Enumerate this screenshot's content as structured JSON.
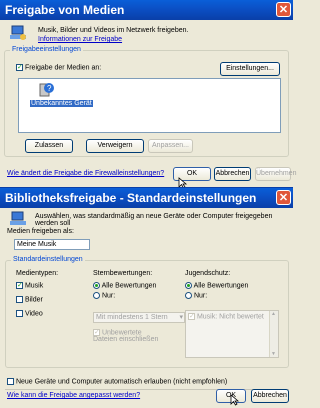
{
  "top": {
    "title": "Freigabe von Medien",
    "desc": "Musik, Bilder und Videos im Netzwerk freigeben.",
    "info_link": "Informationen zur Freigabe",
    "group_label": "Freigabeeinstellungen",
    "share_checkbox": "Freigabe der Medien an:",
    "settings_button": "Einstellungen...",
    "device_label": "Unbekanntes Gerät",
    "allow_button": "Zulassen",
    "deny_button": "Verweigern",
    "customize_button": "Anpassen...",
    "firewall_link": "Wie ändert die Freigabe die Firewalleinstellungen?",
    "ok_button": "OK",
    "cancel_button": "Abbrechen",
    "apply_button": "Übernehmen"
  },
  "bottom": {
    "title": "Bibliotheksfreigabe - Standardeinstellungen",
    "desc": "Auswählen, was standardmäßig an neue Geräte oder Computer freigegeben werden soll",
    "share_as_label": "Medien freigeben als:",
    "share_name_value": "Meine Musik",
    "group_label": "Standardeinstellungen",
    "media_types_label": "Medientypen:",
    "music": "Musik",
    "pictures": "Bilder",
    "video": "Video",
    "star_label": "Sternbewertungen:",
    "all_ratings": "Alle Bewertungen",
    "only": "Nur:",
    "star_select": "Mit mindestens 1 Stern",
    "unrated": "Unbewertete Dateien einschließen",
    "youth_label": "Jugendschutz:",
    "youth_all": "Alle Bewertungen",
    "youth_only": "Nur:",
    "youth_list_item": "Musik: Nicht bewertet",
    "auto_allow": "Neue Geräte und Computer automatisch erlauben (nicht empfohlen)",
    "customize_link": "Wie kann die Freigabe angepasst werden?",
    "ok_button": "OK",
    "cancel_button": "Abbrechen"
  }
}
